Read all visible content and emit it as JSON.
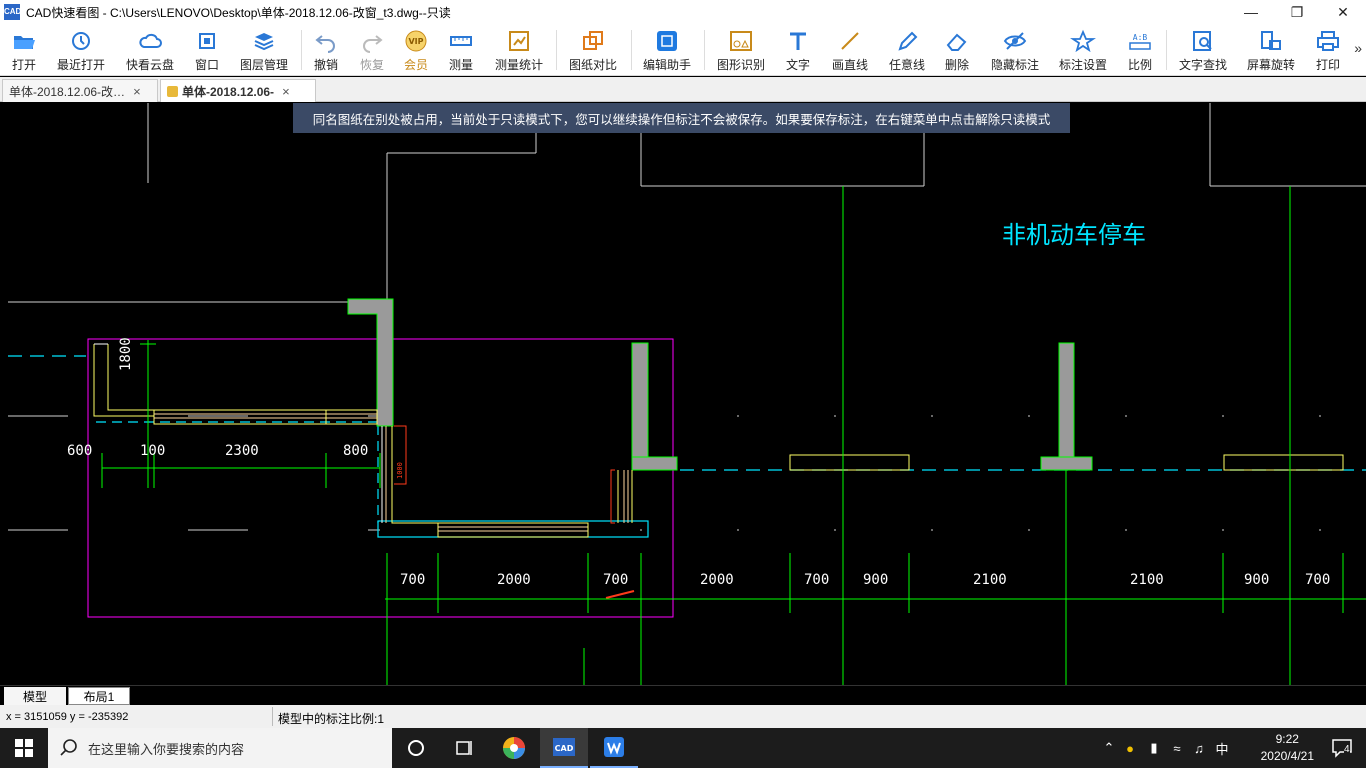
{
  "window": {
    "title": "CAD快速看图 - C:\\Users\\LENOVO\\Desktop\\单体-2018.12.06-改窗_t3.dwg--只读",
    "app_icon": "CAD"
  },
  "toolbar": {
    "items": [
      {
        "label": "打开",
        "icon": "open-folder-icon"
      },
      {
        "label": "最近打开",
        "icon": "history-icon"
      },
      {
        "label": "快看云盘",
        "icon": "cloud-icon"
      },
      {
        "label": "窗口",
        "icon": "window-icon"
      },
      {
        "label": "图层管理",
        "icon": "layers-icon"
      },
      {
        "label": "撤销",
        "icon": "undo-icon"
      },
      {
        "label": "恢复",
        "icon": "redo-icon"
      },
      {
        "label": "会员",
        "icon": "vip-icon",
        "badge": "VIP"
      },
      {
        "label": "测量",
        "icon": "ruler-icon"
      },
      {
        "label": "测量统计",
        "icon": "measure-stats-icon"
      },
      {
        "label": "图纸对比",
        "icon": "compare-icon"
      },
      {
        "label": "编辑助手",
        "icon": "edit-assistant-icon"
      },
      {
        "label": "图形识别",
        "icon": "shape-recognize-icon"
      },
      {
        "label": "文字",
        "icon": "text-icon"
      },
      {
        "label": "画直线",
        "icon": "line-icon"
      },
      {
        "label": "任意线",
        "icon": "pencil-icon"
      },
      {
        "label": "删除",
        "icon": "eraser-icon"
      },
      {
        "label": "隐藏标注",
        "icon": "eye-hide-icon"
      },
      {
        "label": "标注设置",
        "icon": "annotation-settings-icon"
      },
      {
        "label": "比例",
        "icon": "scale-icon",
        "badge": "A:B"
      },
      {
        "label": "文字查找",
        "icon": "text-search-icon"
      },
      {
        "label": "屏幕旋转",
        "icon": "rotate-screen-icon"
      },
      {
        "label": "打印",
        "icon": "print-icon"
      }
    ],
    "more": "»"
  },
  "tabs": [
    {
      "label": "单体-2018.12.06-改…",
      "close": "×"
    },
    {
      "label": "单体-2018.12.06-",
      "close": "×"
    }
  ],
  "notice": "同名图纸在别处被占用，当前处于只读模式下，您可以继续操作但标注不会被保存。如果要保存标注，在右键菜单中点击解除只读模式",
  "drawing": {
    "label": "非机动车停车",
    "dims_left": {
      "h": "1800",
      "a": "600",
      "b": "100",
      "c": "2300",
      "d": "800",
      "small": "1000"
    },
    "dims_bottom": [
      "700",
      "2000",
      "700",
      "2000",
      "700",
      "900",
      "2100",
      "2100",
      "900",
      "700"
    ],
    "colors": {
      "dim": "#00ff00",
      "wall": "#9a9a9a",
      "window": "#ffff66",
      "frame": "#ff00ff",
      "axis": "#00e5ff",
      "text": "#00e5ff",
      "red": "#ff3a1a"
    }
  },
  "layout_tabs": [
    {
      "label": "模型"
    },
    {
      "label": "布局1"
    }
  ],
  "status": {
    "coords": "x = 3151059  y = -235392",
    "scale": "模型中的标注比例:1"
  },
  "taskbar": {
    "search_placeholder": "在这里输入你要搜索的内容",
    "ime": "中",
    "time": "9:22",
    "date": "2020/4/21",
    "notifications": "4"
  }
}
